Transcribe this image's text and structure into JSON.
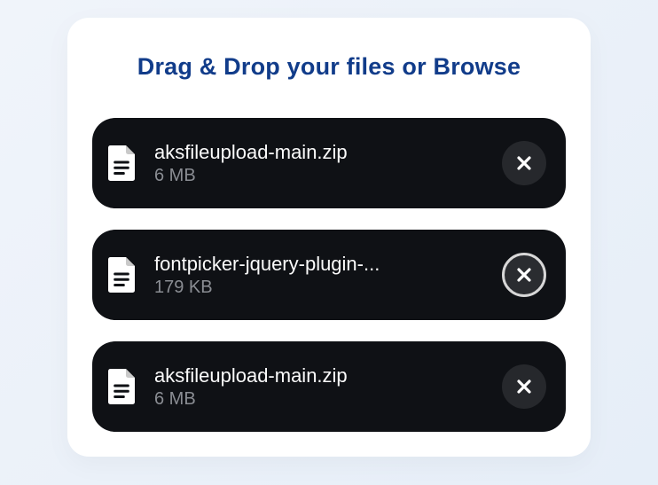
{
  "title_prefix": "Drag & Drop your files or ",
  "title_action": "Browse",
  "files": [
    {
      "name": "aksfileupload-main.zip",
      "size": "6 MB",
      "focused": false
    },
    {
      "name": "fontpicker-jquery-plugin-...",
      "size": "179 KB",
      "focused": true
    },
    {
      "name": "aksfileupload-main.zip",
      "size": "6 MB",
      "focused": false
    }
  ]
}
